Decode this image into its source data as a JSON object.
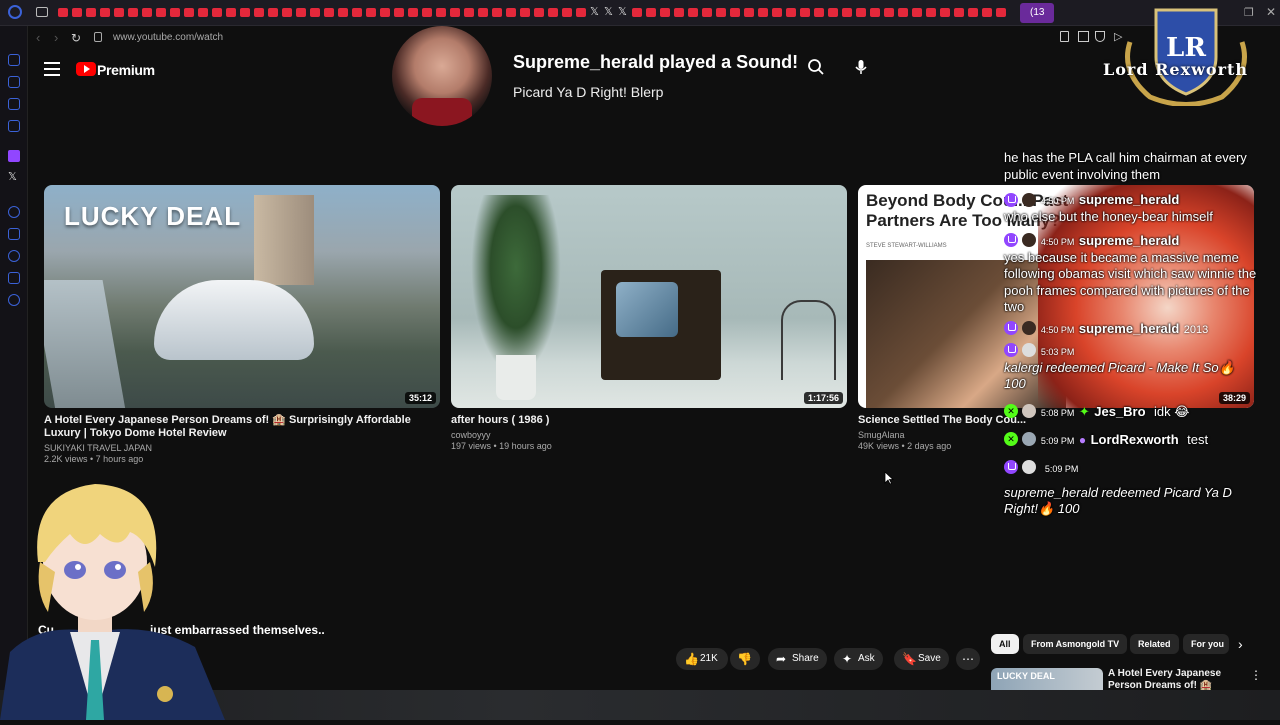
{
  "browser": {
    "url": "www.youtube.com/watch",
    "active_tab_label": "(13"
  },
  "youtube": {
    "brand": "Premium"
  },
  "alert": {
    "title": "Supreme_herald played a Sound!",
    "subtitle": "Picard Ya D Right! Blerp"
  },
  "overlay_logo": {
    "monogram": "LR",
    "name": "Lord Rexworth"
  },
  "videos": [
    {
      "thumb_text": "LUCKY DEAL",
      "duration": "35:12",
      "title": "A Hotel Every Japanese Person Dreams of! 🏨 Surprisingly Affordable Luxury | Tokyo Dome Hotel Review",
      "channel": "SUKIYAKI TRAVEL JAPAN",
      "meta": "2.2K views • 7 hours ago"
    },
    {
      "duration": "1:17:56",
      "title": "after hours ( 1986 )",
      "channel": "cowboyyy",
      "meta": "197 views • 19 hours ago"
    },
    {
      "thumb_text": "Beyond Body Cou... Past Partners Are Too Many?",
      "thumb_byline": "STEVE STEWART-WILLIAMS",
      "duration": "38:29",
      "title": "Science Settled The Body Cou...",
      "channel": "SmugAlana",
      "meta": "49K views • 2 days ago"
    }
  ],
  "chat": {
    "msg0": "he has the PLA call him chairman at every public event involving them",
    "m1_time": "4:50 PM",
    "m1_user": "supreme_herald",
    "m1_text": "who else but the honey-bear himself",
    "m2_time": "4:50 PM",
    "m2_user": "supreme_herald",
    "m2_text": "yes because it became a massive meme following obamas visit which saw winnie the pooh frames compared with pictures of the two",
    "m3_time": "4:50 PM",
    "m3_user": "supreme_herald",
    "m3_badge": "2013",
    "m4_time": "5:03 PM",
    "m4_text": "kalergi redeemed Picard - Make It So🔥 100",
    "m5_time": "5:08 PM",
    "m5_user": "Jes_Bro",
    "m5_text": "idk 😂",
    "m6_time": "5:09 PM",
    "m6_user": "LordRexworth",
    "m6_text": "test",
    "m7_time": "5:09 PM",
    "m7_text": "supreme_herald redeemed Picard Ya D Right!🔥 100"
  },
  "watch": {
    "title_start": "Cu",
    "title_end": "just embarrassed themselves..",
    "like_count": "21K",
    "share_label": "Share",
    "ask_label": "Ask",
    "save_label": "Save"
  },
  "chips": [
    "All",
    "From Asmongold TV",
    "Related",
    "For you"
  ],
  "related": {
    "thumb_text": "LUCKY DEAL",
    "title": "A Hotel Every Japanese Person Dreams of! 🏨 Surprisingly..."
  },
  "colors": {
    "youtube_red": "#ff0000",
    "twitch_purple": "#9146ff",
    "kick_green": "#53fc18",
    "background": "#0f0f0f"
  }
}
